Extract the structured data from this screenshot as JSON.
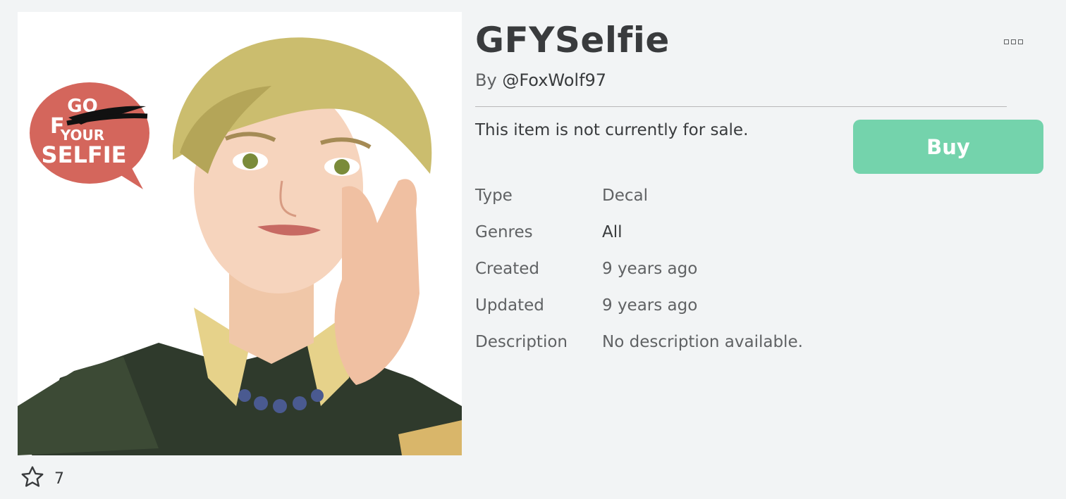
{
  "item": {
    "title": "GFYSelfie",
    "creator_prefix": "By",
    "creator": "@FoxWolf97",
    "sale_status": "This item is not currently for sale.",
    "buy_label": "Buy",
    "favorite_count": "7",
    "thumbnail_badge": [
      "GO",
      "F",
      "YOUR",
      "SELFIE"
    ]
  },
  "details": [
    {
      "label": "Type",
      "value": "Decal"
    },
    {
      "label": "Genres",
      "value": "All"
    },
    {
      "label": "Created",
      "value": "9 years ago"
    },
    {
      "label": "Updated",
      "value": "9 years ago"
    },
    {
      "label": "Description",
      "value": "No description available."
    }
  ],
  "colors": {
    "buy_button": "#74d3ac",
    "background": "#f2f4f5",
    "text_primary": "#393b3d",
    "text_secondary": "#606264"
  },
  "icons": {
    "favorite": "star-outline-icon",
    "more": "more-options-icon"
  }
}
